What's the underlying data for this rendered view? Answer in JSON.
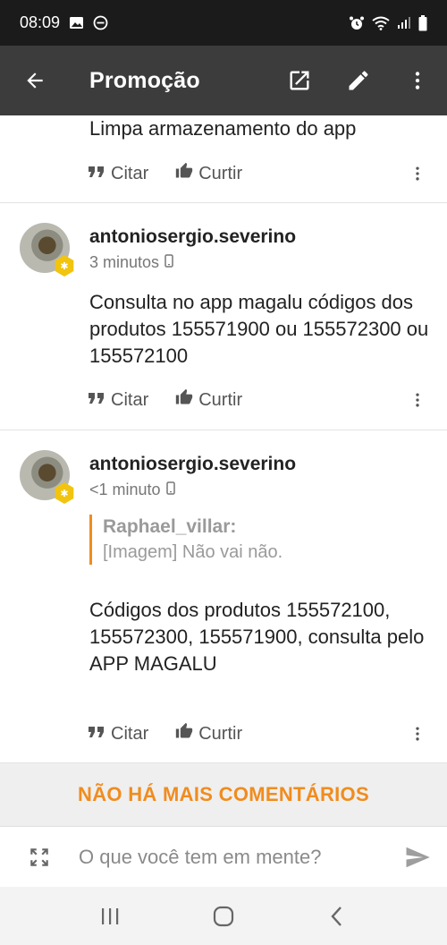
{
  "status": {
    "time": "08:09",
    "left_icons": [
      "image-icon",
      "dnd-icon"
    ],
    "right_icons": [
      "alarm-icon",
      "wifi-icon",
      "signal-icon",
      "battery-icon"
    ]
  },
  "app_bar": {
    "title": "Promoção",
    "icons": [
      "back-arrow-icon",
      "open-external-icon",
      "edit-pencil-icon",
      "more-vert-icon"
    ]
  },
  "posts": [
    {
      "body": "Limpa armazenamento do app",
      "actions": {
        "quote": "Citar",
        "like": "Curtir"
      }
    },
    {
      "username": "antoniosergio.severino",
      "time": "3 minutos",
      "body": "Consulta no app magalu códigos dos produtos 155571900 ou 155572300 ou 155572100",
      "actions": {
        "quote": "Citar",
        "like": "Curtir"
      }
    },
    {
      "username": "antoniosergio.severino",
      "time": "<1 minuto",
      "quote": {
        "author": "Raphael_villar:",
        "text": "[Imagem] Não vai não."
      },
      "body": "Códigos dos produtos 155572100, 155572300, 155571900, consulta pelo APP MAGALU",
      "actions": {
        "quote": "Citar",
        "like": "Curtir"
      }
    }
  ],
  "end_banner": "NÃO HÁ MAIS COMENTÁRIOS",
  "composer": {
    "placeholder": "O que você tem em mente?",
    "icons": [
      "expand-icon",
      "send-icon"
    ]
  },
  "nav": {
    "icons": [
      "recents-icon",
      "home-icon",
      "back-icon"
    ]
  },
  "colors": {
    "accent": "#f08c1e",
    "app_bar": "#3c3c3c",
    "status_bar": "#1b1b1b"
  }
}
